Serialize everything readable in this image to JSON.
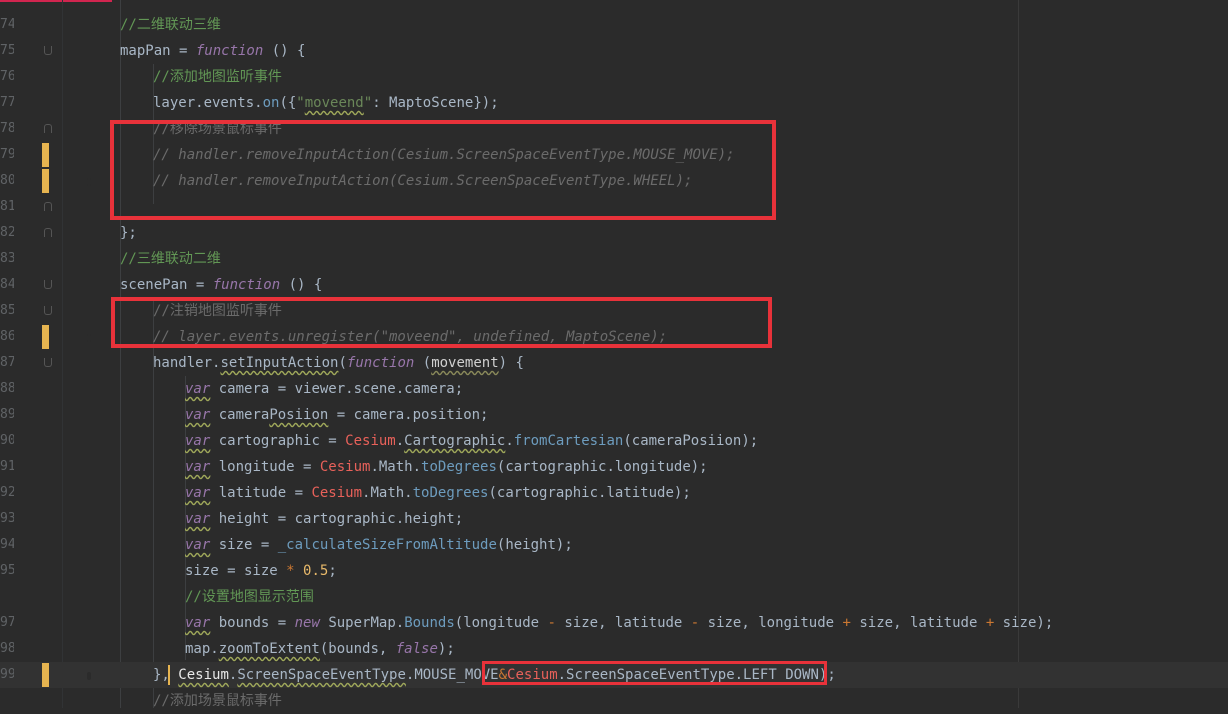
{
  "editor": {
    "accent": "#d1254f",
    "highlight_color": "#e8323a"
  },
  "line_numbers": [
    "74",
    "75",
    "76",
    "77",
    "78",
    "79",
    "80",
    "81",
    "82",
    "83",
    "84",
    "85",
    "86",
    "87",
    "88",
    "89",
    "90",
    "91",
    "92",
    "93",
    "94",
    "95",
    "97",
    "98",
    "99"
  ],
  "lines": {
    "l74": {
      "c1": "//二维联动三维"
    },
    "l75": {
      "c1": "mapPan = ",
      "c2": "function",
      "c3": " () {"
    },
    "l76": {
      "c1": "//添加地图监听事件"
    },
    "l77": {
      "c1": "layer.events.",
      "c2": "on",
      "c3": "({",
      "c4": "\"",
      "c5": "moveend",
      "c6": "\"",
      "c7": ": MaptoScene});"
    },
    "l78": {
      "c1": "//移除场景鼠标事件"
    },
    "l79": {
      "c1": "// handler.removeInputAction(Cesium.ScreenSpaceEventType.MOUSE_MOVE);"
    },
    "l80": {
      "c1": "// handler.removeInputAction(Cesium.ScreenSpaceEventType.WHEEL);"
    },
    "l82": {
      "c1": "};"
    },
    "l83": {
      "c1": "//三维联动二维"
    },
    "l84": {
      "c1": "scenePan = ",
      "c2": "function",
      "c3": " () {"
    },
    "l85": {
      "c1": "//注销地图监听事件"
    },
    "l86": {
      "c1": "// layer.events.unregister(\"moveend\", undefined, MaptoScene);"
    },
    "l87": {
      "c1": "handler.",
      "c2": "setInputAction",
      "c3": "(",
      "c4": "function",
      "c5": " (",
      "c6": "movement",
      "c7": ") {"
    },
    "l88": {
      "c1": "var",
      "c2": " camera = viewer.scene.camera;"
    },
    "l89": {
      "c1": "var",
      "c2": " camera",
      "c3": "Posiion",
      "c4": " = camera.position;"
    },
    "l90": {
      "c1": "var",
      "c2": " cartographic = ",
      "c3": "Cesium",
      "c4": ".",
      "c5": "Cartographic",
      "c6": ".",
      "c7": "fromCartesian",
      "c8": "(cameraPosiion);"
    },
    "l91": {
      "c1": "var",
      "c2": " longitude = ",
      "c3": "Cesium",
      "c4": ".Math.",
      "c5": "toDegrees",
      "c6": "(cartographic.longitude);"
    },
    "l92": {
      "c1": "var",
      "c2": " latitude = ",
      "c3": "Cesium",
      "c4": ".Math.",
      "c5": "toDegrees",
      "c6": "(cartographic.latitude);"
    },
    "l93": {
      "c1": "var",
      "c2": " height = cartographic.height;"
    },
    "l94": {
      "c1": "var",
      "c2": " size = ",
      "c3": "_calculateSizeFromAltitude",
      "c4": "(height);"
    },
    "l95": {
      "c1": "size = size ",
      "c2": "*",
      "c3": " ",
      "c4": "0.5",
      "c5": ";"
    },
    "l96": {
      "c1": "//设置地图显示范围"
    },
    "l97": {
      "c1": "var",
      "c2": " bounds = ",
      "c3": "new",
      "c4": " SuperMap.",
      "c5": "Bounds",
      "c6": "(longitude ",
      "c7": "-",
      "c8": " size, latitude ",
      "c9": "-",
      "c10": " size, longitude ",
      "c11": "+",
      "c12": " size, latitude ",
      "c13": "+",
      "c14": " size);"
    },
    "l98": {
      "c1": "map.",
      "c2": "zoomToExtent",
      "c3": "(bounds, ",
      "c4": "false",
      "c5": ");"
    },
    "l99": {
      "c1": "},",
      "c2": " ",
      "c3": "Cesium",
      "c4": ".",
      "c5": "ScreenSpaceEventType",
      "c6": ".MOUSE_MOVE",
      "c7": "&",
      "c8": "Cesium",
      "c9": ".ScreenSpaceEventType.LEFT_DOWN);"
    },
    "l100": {
      "c1": "//添加场景鼠标事件"
    }
  }
}
